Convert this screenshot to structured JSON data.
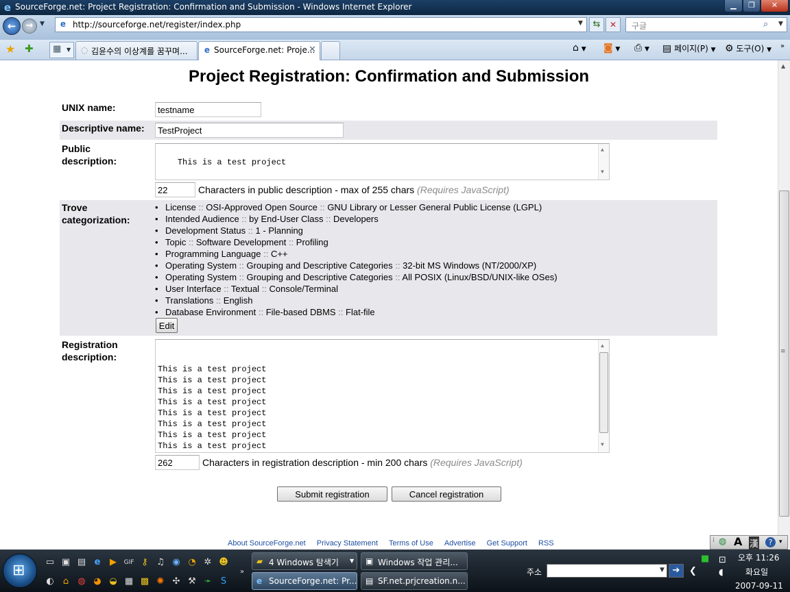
{
  "window": {
    "title": "SourceForge.net: Project Registration: Confirmation and Submission - Windows Internet Explorer",
    "min": "▁",
    "max": "❐",
    "close": "✕"
  },
  "address_bar": {
    "url": "http://sourceforge.net/register/index.php"
  },
  "search": {
    "placeholder": "구글"
  },
  "tabs": [
    {
      "label": "김윤수의 이상계를 꿈꾸며...",
      "icon": "loading-icon",
      "active": false
    },
    {
      "label": "SourceForge.net: Proje...",
      "icon": "ie-page-icon",
      "active": true
    }
  ],
  "command_bar": {
    "page": "페이지(P)",
    "tools": "도구(O)"
  },
  "page": {
    "title": "Project Registration: Confirmation and Submission",
    "unix_name": {
      "label": "UNIX name:",
      "value": "testname"
    },
    "descriptive_name": {
      "label": "Descriptive name:",
      "value": "TestProject"
    },
    "public_description": {
      "label_line1": "Public",
      "label_line2": "description:",
      "value": "This is a test project",
      "char_count": "22",
      "count_text": "Characters in public description - max of 255 chars",
      "count_note": "(Requires JavaScript)"
    },
    "trove": {
      "label_line1": "Trove",
      "label_line2": "categorization:",
      "items": [
        [
          "License",
          "OSI-Approved Open Source",
          "GNU Library or Lesser General Public License (LGPL)"
        ],
        [
          "Intended Audience",
          "by End-User Class",
          "Developers"
        ],
        [
          "Development Status",
          "1 - Planning"
        ],
        [
          "Topic",
          "Software Development",
          "Profiling"
        ],
        [
          "Programming Language",
          "C++"
        ],
        [
          "Operating System",
          "Grouping and Descriptive Categories",
          "32-bit MS Windows (NT/2000/XP)"
        ],
        [
          "Operating System",
          "Grouping and Descriptive Categories",
          "All POSIX (Linux/BSD/UNIX-like OSes)"
        ],
        [
          "User Interface",
          "Textual",
          "Console/Terminal"
        ],
        [
          "Translations",
          "English"
        ],
        [
          "Database Environment",
          "File-based DBMS",
          "Flat-file"
        ]
      ],
      "edit_label": "Edit"
    },
    "registration_description": {
      "label_line1": "Registration",
      "label_line2": "description:",
      "lines": [
        "This is a test project",
        "This is a test project",
        "This is a test project",
        "This is a test project",
        "This is a test project",
        "This is a test project",
        "This is a test project",
        "This is a test project",
        "This is a test project",
        "This is a test project"
      ],
      "char_count": "262",
      "count_text": "Characters in registration description - min 200 chars",
      "count_note": "(Requires JavaScript)"
    },
    "submit_label": "Submit registration",
    "cancel_label": "Cancel registration",
    "footer_links": [
      "About SourceForge.net",
      "Privacy Statement",
      "Terms of Use",
      "Advertise",
      "Get Support",
      "RSS"
    ]
  },
  "ime": {
    "mode": "A",
    "hanja": "漢",
    "help": "?"
  },
  "taskbar": {
    "tasks": [
      {
        "label": "4 Windows 탐색기",
        "icon": "folder-icon"
      },
      {
        "label": "Windows 작업 관리...",
        "icon": "task-manager-icon"
      },
      {
        "label": "SourceForge.net: Pr...",
        "icon": "ie-icon"
      },
      {
        "label": "SF.net.prjcreation.n...",
        "icon": "text-file-icon"
      }
    ],
    "address_label": "주소",
    "clock_time": "오후 11:26",
    "clock_day": "화요일",
    "clock_date": "2007-09-11"
  }
}
